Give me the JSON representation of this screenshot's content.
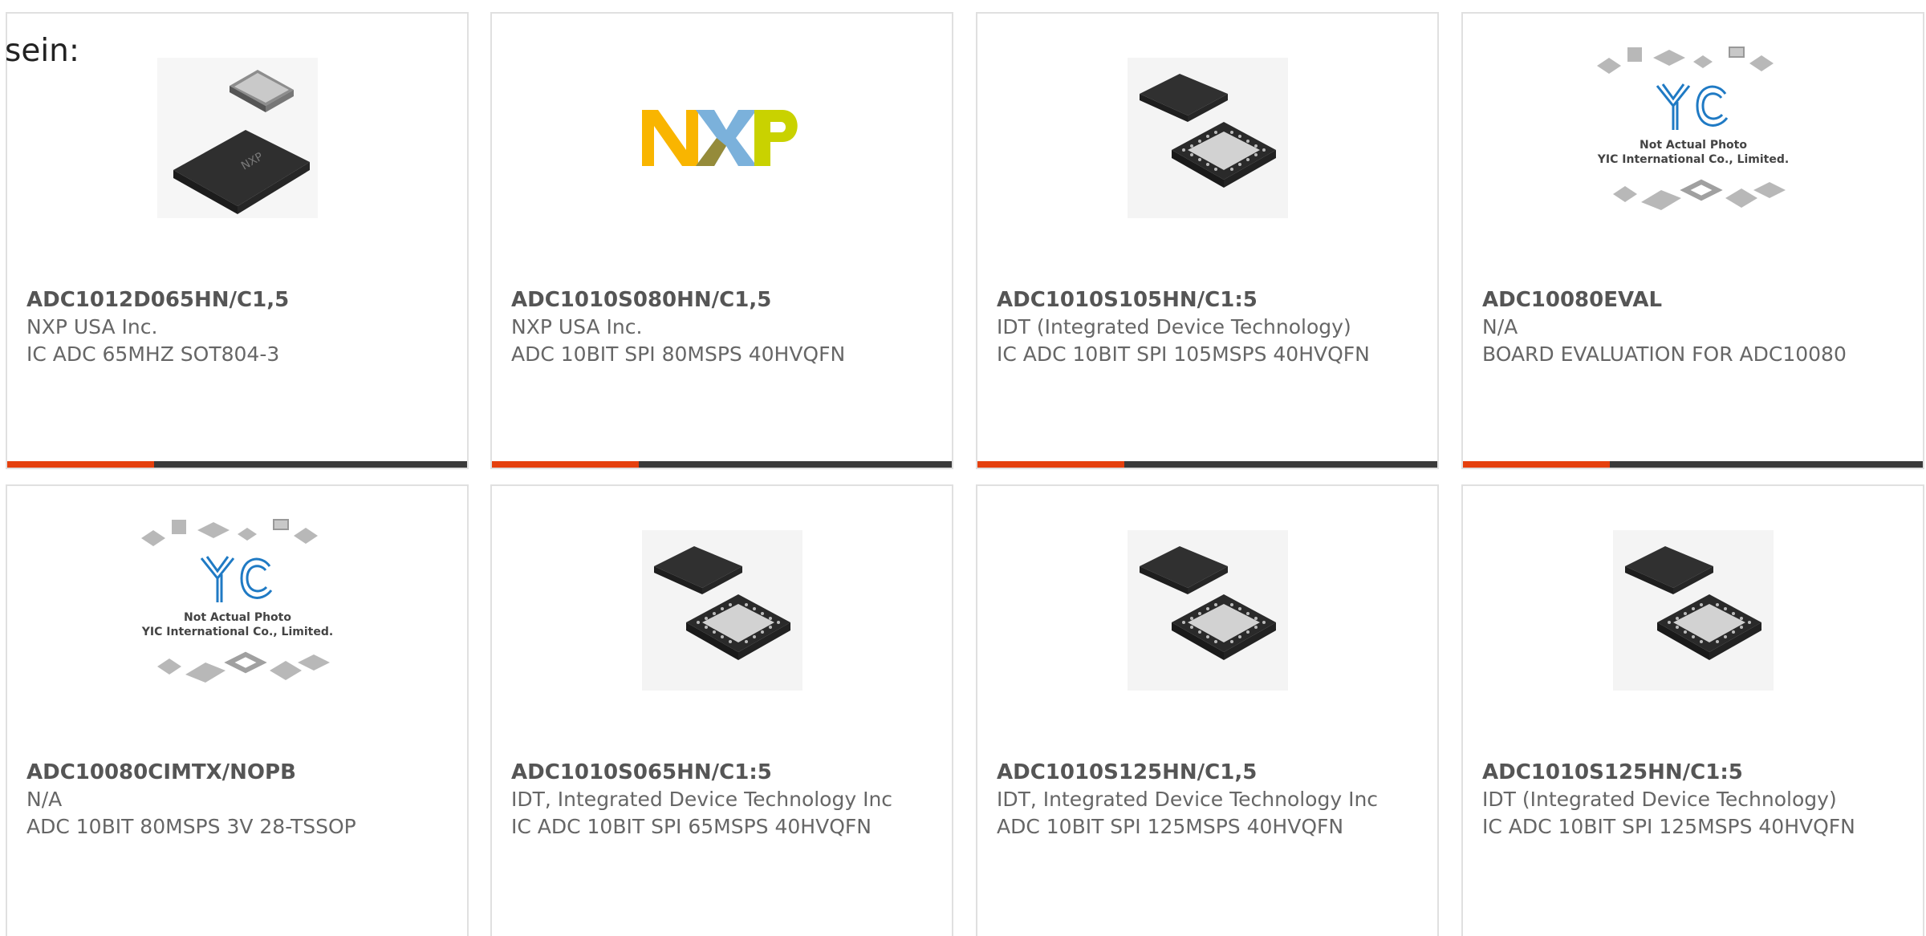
{
  "intro_text": "sein:",
  "colors": {
    "accent": "#e5400e",
    "bar": "#3a3a3a",
    "border": "#e0e0e0"
  },
  "products": [
    {
      "part_number": "ADC1012D065HN/C1,5",
      "manufacturer": "NXP USA Inc.",
      "description": "IC ADC 65MHZ SOT804-3",
      "image": "nxp-chip-photo"
    },
    {
      "part_number": "ADC1010S080HN/C1,5",
      "manufacturer": "NXP USA Inc.",
      "description": "ADC 10BIT SPI 80MSPS 40HVQFN",
      "image": "nxp-logo"
    },
    {
      "part_number": "ADC1010S105HN/C1:5",
      "manufacturer": "IDT (Integrated Device Technology)",
      "description": "IC ADC 10BIT SPI 105MSPS 40HVQFN",
      "image": "qfn-chip-photo"
    },
    {
      "part_number": "ADC10080EVAL",
      "manufacturer": "N/A",
      "description": "BOARD EVALUATION FOR ADC10080",
      "image": "yic-placeholder",
      "placeholder_line1": "Not Actual Photo",
      "placeholder_line2": "YIC International Co., Limited."
    },
    {
      "part_number": "ADC10080CIMTX/NOPB",
      "manufacturer": "N/A",
      "description": "ADC 10BIT 80MSPS 3V 28-TSSOP",
      "image": "yic-placeholder",
      "placeholder_line1": "Not Actual Photo",
      "placeholder_line2": "YIC International Co., Limited."
    },
    {
      "part_number": "ADC1010S065HN/C1:5",
      "manufacturer": "IDT, Integrated Device Technology Inc",
      "description": "IC ADC 10BIT SPI 65MSPS 40HVQFN",
      "image": "qfn-chip-photo"
    },
    {
      "part_number": "ADC1010S125HN/C1,5",
      "manufacturer": "IDT, Integrated Device Technology Inc",
      "description": "ADC 10BIT SPI 125MSPS 40HVQFN",
      "image": "qfn-chip-photo"
    },
    {
      "part_number": "ADC1010S125HN/C1:5",
      "manufacturer": "IDT (Integrated Device Technology)",
      "description": "IC ADC 10BIT SPI 125MSPS 40HVQFN",
      "image": "qfn-chip-photo"
    }
  ]
}
